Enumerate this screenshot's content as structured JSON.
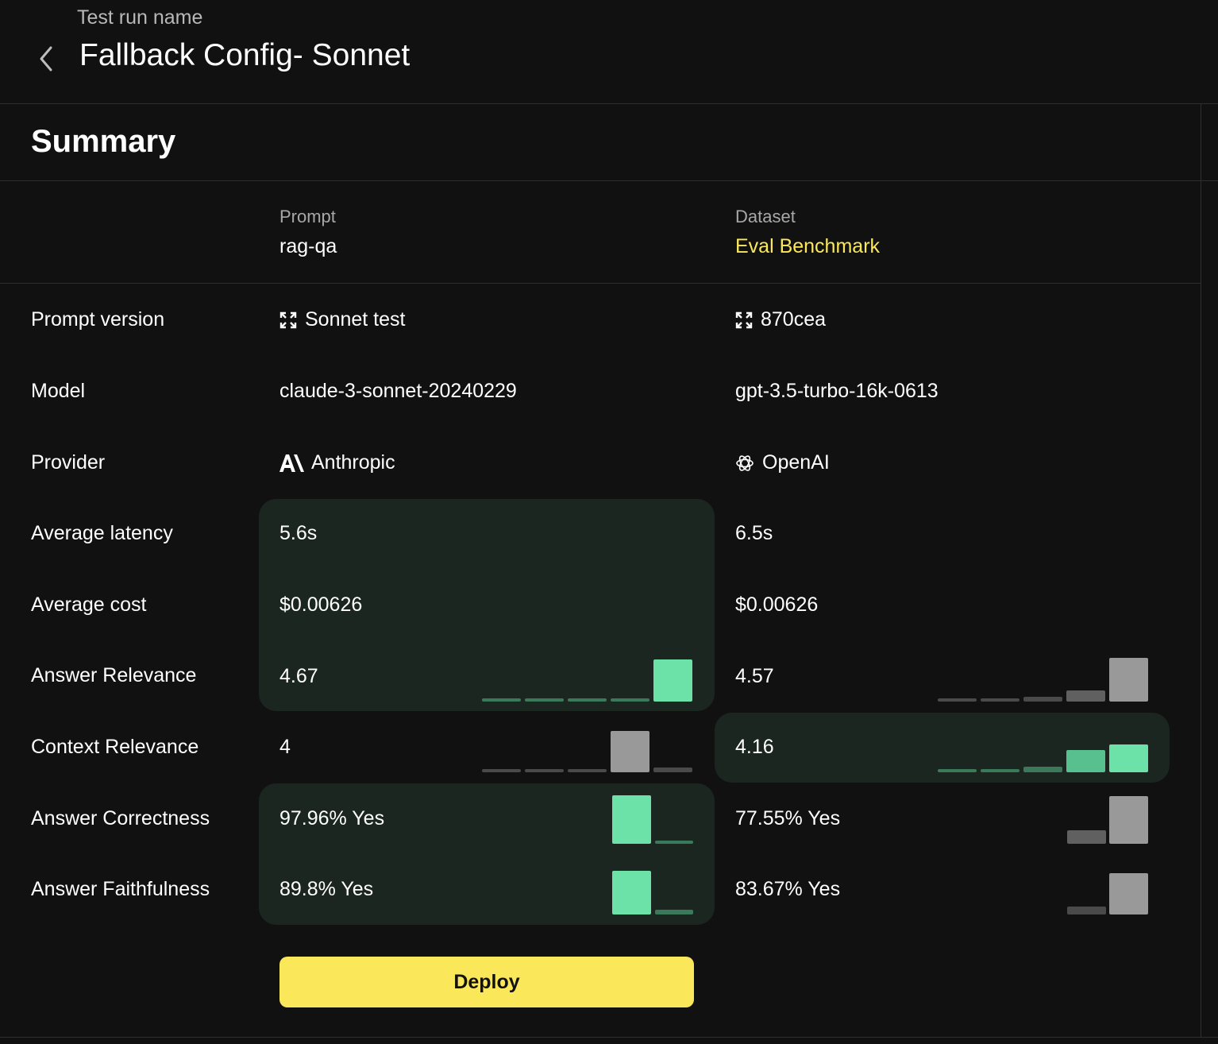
{
  "header": {
    "label": "Test run name",
    "title": "Fallback Config- Sonnet"
  },
  "summary": {
    "title": "Summary"
  },
  "columns": {
    "prompt": {
      "label": "Prompt",
      "value": "rag-qa"
    },
    "dataset": {
      "label": "Dataset",
      "value": "Eval Benchmark"
    }
  },
  "rows": {
    "prompt_version": {
      "label": "Prompt version",
      "a": "Sonnet test",
      "b": "870cea"
    },
    "model": {
      "label": "Model",
      "a": "claude-3-sonnet-20240229",
      "b": "gpt-3.5-turbo-16k-0613"
    },
    "provider": {
      "label": "Provider",
      "a": "Anthropic",
      "b": "OpenAI"
    },
    "avg_latency": {
      "label": "Average latency",
      "a": "5.6s",
      "b": "6.5s"
    },
    "avg_cost": {
      "label": "Average cost",
      "a": "$0.00626",
      "b": "$0.00626"
    },
    "answer_relevance": {
      "label": "Answer Relevance",
      "a": "4.67",
      "b": "4.57"
    },
    "context_relevance": {
      "label": "Context Relevance",
      "a": "4",
      "b": "4.16"
    },
    "answer_correctness": {
      "label": "Answer Correctness",
      "a": "97.96% Yes",
      "b": "77.55% Yes"
    },
    "answer_faithfulness": {
      "label": "Answer Faithfulness",
      "a": "89.8% Yes",
      "b": "83.67% Yes"
    }
  },
  "deploy_label": "Deploy",
  "colors": {
    "accent": "#fbe85a",
    "highlight_bg": "#1b2621",
    "bar_green": "#6de2a8",
    "bar_green_mid": "#57c08e",
    "bar_green_dim": "#3a7a5a",
    "bar_gray": "#999999",
    "bar_gray_mid": "#606060",
    "bar_gray_dim": "#4a4a4a"
  },
  "icons": {
    "back": "chevron-left-icon",
    "version": "expand-icon",
    "anthropic": "anthropic-logo-icon",
    "openai": "openai-logo-icon"
  }
}
